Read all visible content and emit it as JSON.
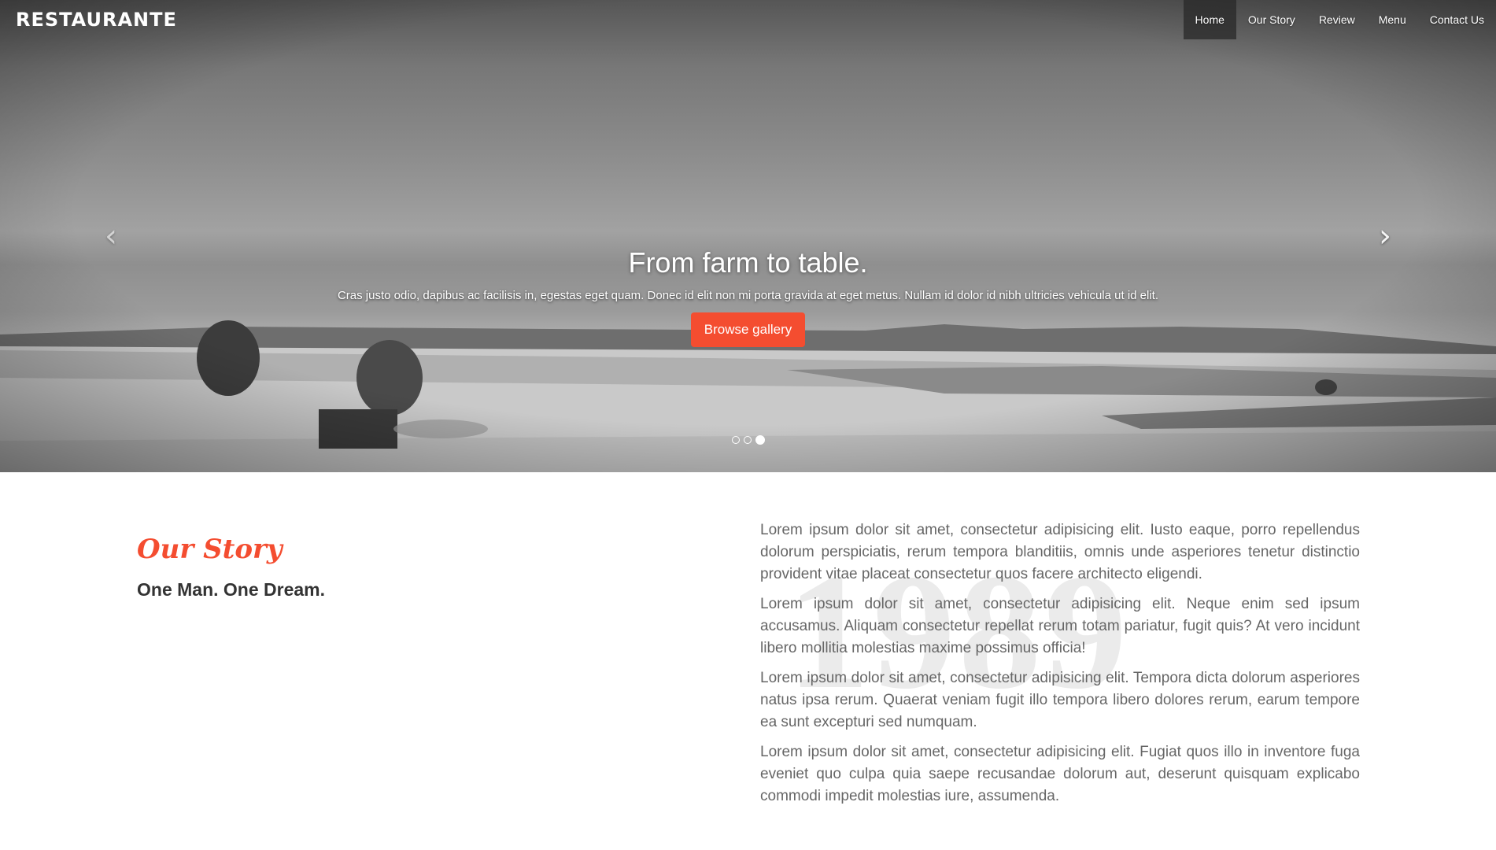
{
  "navbar": {
    "brand": "RESTAURANTE",
    "links": [
      "Home",
      "Our Story",
      "Review",
      "Menu",
      "Contact Us"
    ],
    "active_index": 0
  },
  "hero": {
    "title": "From farm to table.",
    "text": "Cras justo odio, dapibus ac facilisis in, egestas eget quam. Donec id elit non mi porta gravida at eget metus. Nullam id dolor id nibh ultricies vehicula ut id elit.",
    "button_label": "Browse gallery",
    "prev_icon": "chevron-left-icon",
    "next_icon": "chevron-right-icon",
    "slide_count": 3,
    "active_slide": 3
  },
  "story": {
    "title": "Our Story",
    "subtitle": "One Man. One Dream.",
    "year": "1989",
    "paragraphs": [
      "Lorem ipsum dolor sit amet, consectetur adipisicing elit. Iusto eaque, porro repellendus dolorum perspiciatis, rerum tempora blanditiis, omnis unde asperiores tenetur distinctio provident vitae placeat consectetur quos facere architecto eligendi.",
      "Lorem ipsum dolor sit amet, consectetur adipisicing elit. Neque enim sed ipsum accusamus. Aliquam consectetur repellat rerum totam pariatur, fugit quis? At vero incidunt libero mollitia molestias maxime possimus officia!",
      "Lorem ipsum dolor sit amet, consectetur adipisicing elit. Tempora dicta dolorum asperiores natus ipsa rerum. Quaerat veniam fugit illo tempora libero dolores rerum, earum tempore ea sunt excepturi sed numquam.",
      "Lorem ipsum dolor sit amet, consectetur adipisicing elit. Fugiat quos illo in inventore fuga eveniet quo culpa quia saepe recusandae dolorum aut, deserunt quisquam explicabo commodi impedit molestias iure, assumenda."
    ]
  },
  "colors": {
    "accent": "#f44d30",
    "nav_active_bg": "#2d2d2d",
    "heading_dark": "#333333",
    "body_text": "#666666"
  }
}
